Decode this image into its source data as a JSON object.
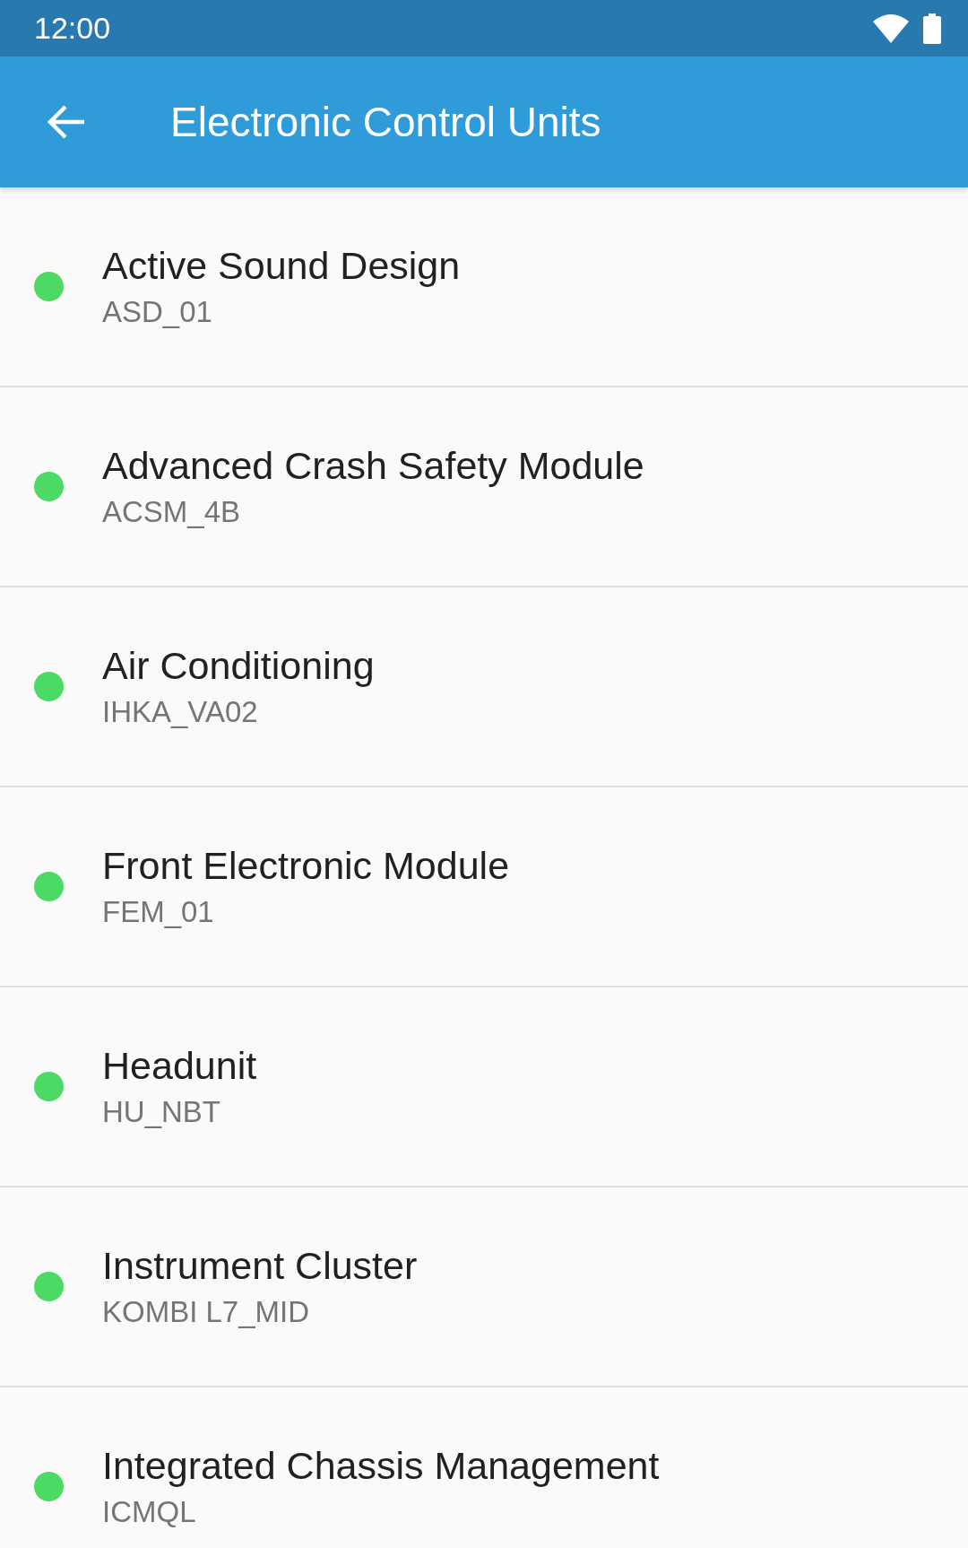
{
  "status_bar": {
    "time": "12:00"
  },
  "app_bar": {
    "title": "Electronic Control Units"
  },
  "units": [
    {
      "name": "Active Sound Design",
      "code": "ASD_01",
      "color": "#4cd964"
    },
    {
      "name": "Advanced Crash Safety Module",
      "code": "ACSM_4B",
      "color": "#4cd964"
    },
    {
      "name": "Air Conditioning",
      "code": "IHKA_VA02",
      "color": "#4cd964"
    },
    {
      "name": "Front Electronic Module",
      "code": "FEM_01",
      "color": "#4cd964"
    },
    {
      "name": "Headunit",
      "code": "HU_NBT",
      "color": "#4cd964"
    },
    {
      "name": "Instrument Cluster",
      "code": "KOMBI L7_MID",
      "color": "#4cd964"
    },
    {
      "name": "Integrated Chassis Management",
      "code": "ICMQL",
      "color": "#4cd964"
    }
  ]
}
